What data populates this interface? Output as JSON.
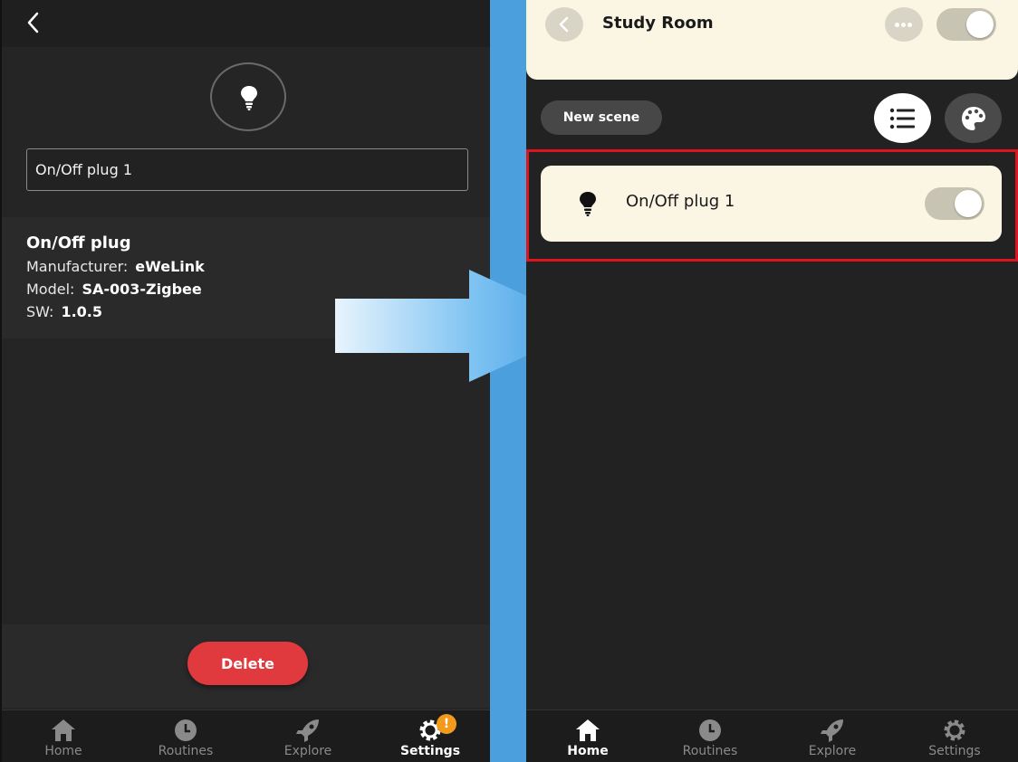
{
  "left_screen": {
    "device_name_value": "On/Off plug 1",
    "info": {
      "title": "On/Off plug",
      "manufacturer_label": "Manufacturer:",
      "manufacturer_value": "eWeLink",
      "model_label": "Model:",
      "model_value": "SA-003-Zigbee",
      "sw_label": "SW:",
      "sw_value": "1.0.5"
    },
    "delete_label": "Delete",
    "tabs": [
      {
        "label": "Home",
        "icon": "home-icon"
      },
      {
        "label": "Routines",
        "icon": "clock-icon"
      },
      {
        "label": "Explore",
        "icon": "rocket-icon"
      },
      {
        "label": "Settings",
        "icon": "gear-icon",
        "badge": "!",
        "active": true
      }
    ]
  },
  "right_screen": {
    "room_title": "Study Room",
    "new_scene_label": "New scene",
    "device_card": {
      "name": "On/Off plug 1",
      "icon": "bulb-icon",
      "toggle_on": true
    },
    "room_toggle_on": true,
    "tabs": [
      {
        "label": "Home",
        "icon": "home-icon",
        "active": true
      },
      {
        "label": "Routines",
        "icon": "clock-icon"
      },
      {
        "label": "Explore",
        "icon": "rocket-icon"
      },
      {
        "label": "Settings",
        "icon": "gear-icon"
      }
    ]
  },
  "colors": {
    "accent_delete": "#e03a3e",
    "badge": "#f39a1c",
    "card": "#fbf6e4",
    "highlight_border": "#e0141e",
    "background_blue": "#4a9fdc"
  }
}
